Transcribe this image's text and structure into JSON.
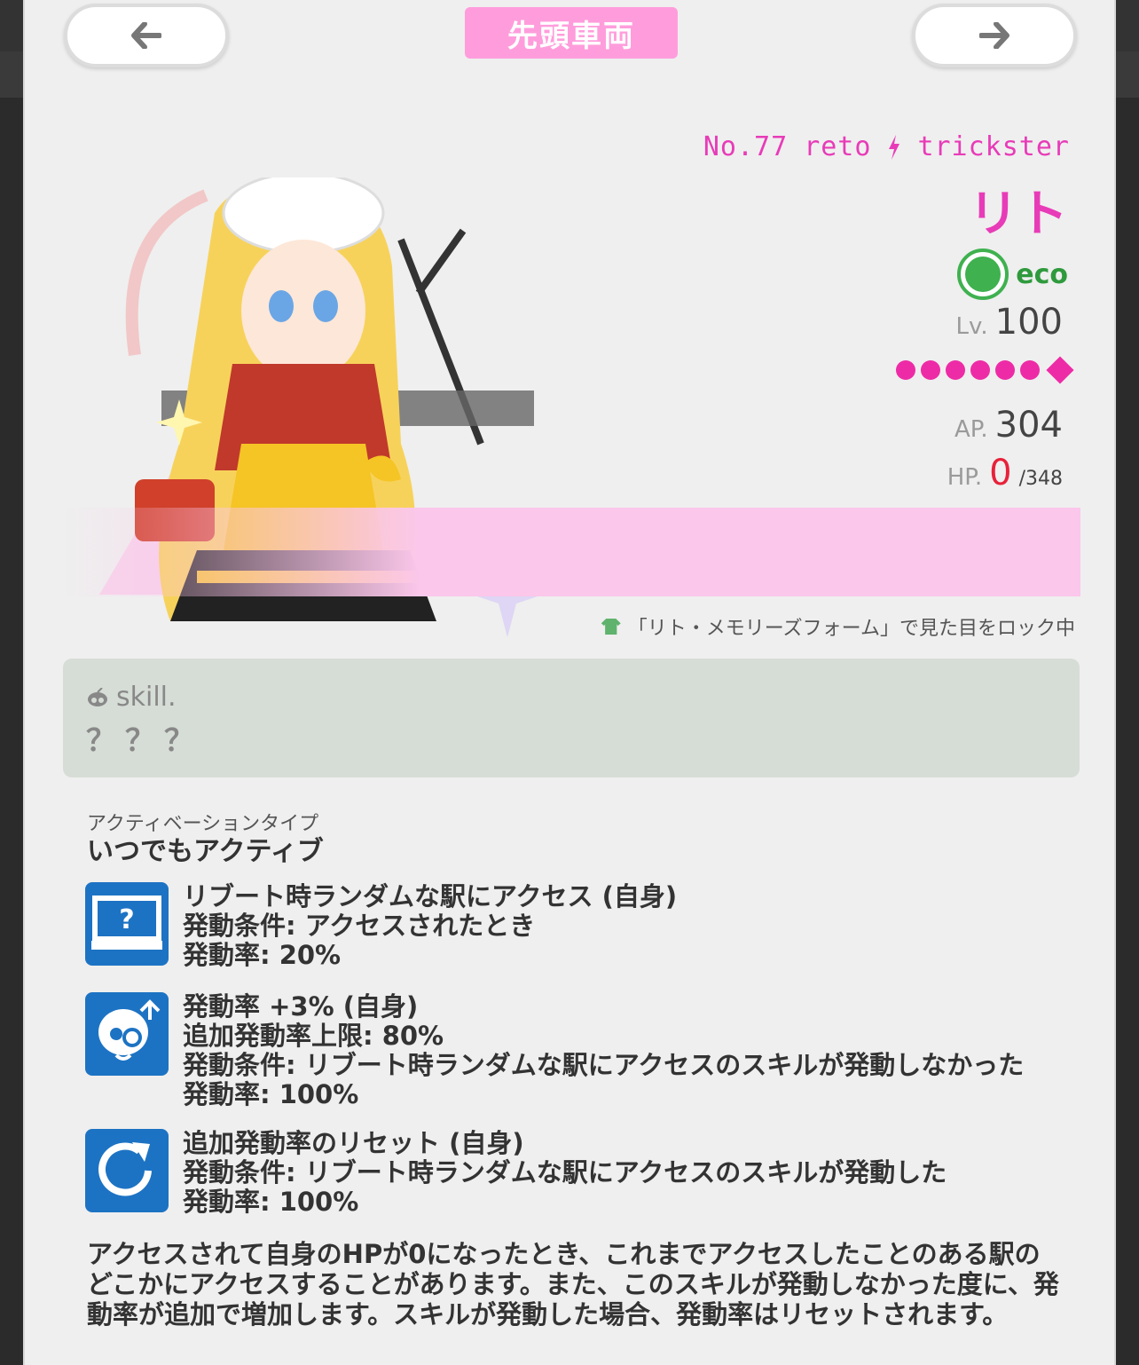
{
  "header": {
    "prev_icon": "arrow-left-icon",
    "next_icon": "arrow-right-icon",
    "badge": "先頭車両"
  },
  "character": {
    "number": "No.77",
    "code": "reto",
    "type_icon": "lightning-icon",
    "type": "trickster",
    "name": "リト",
    "attribute": "eco",
    "lv_label": "Lv.",
    "lv": "100",
    "rank_dots": 6,
    "rank_diamonds": 1,
    "ap_label": "AP.",
    "ap": "304",
    "hp_label": "HP.",
    "hp_current": "0",
    "hp_max": "/348",
    "lock_note": "「リト・メモリーズフォーム」で見た目をロック中"
  },
  "skill": {
    "label": "skill.",
    "name": "？？？",
    "activation_label": "アクティベーションタイプ",
    "activation": "いつでもアクティブ",
    "effects": [
      {
        "icon": "monitor-question-icon",
        "lines": [
          "リブート時ランダムな駅にアクセス (自身)",
          "発動条件: アクセスされたとき",
          "発動率: 20%"
        ]
      },
      {
        "icon": "character-up-icon",
        "lines": [
          "発動率 +3% (自身)",
          "追加発動率上限: 80%",
          "発動条件: リブート時ランダムな駅にアクセスのスキルが発動しなかった",
          "発動率: 100%"
        ]
      },
      {
        "icon": "reset-arrow-icon",
        "lines": [
          "追加発動率のリセット (自身)",
          "発動条件: リブート時ランダムな駅にアクセスのスキルが発動した",
          "発動率: 100%"
        ]
      }
    ],
    "description": "アクセスされて自身のHPが0になったとき、これまでアクセスしたことのある駅のどこかにアクセスすることがあります。また、このスキルが発動しなかった度に、発動率が追加で増加します。スキルが発動した場合、発動率はリセットされます。"
  },
  "colors": {
    "accent_pink": "#e83bb8",
    "badge_pink": "#ff9ddc",
    "eco_green": "#3fb14f",
    "hp_red": "#e8213a",
    "icon_blue": "#1d73c3"
  }
}
